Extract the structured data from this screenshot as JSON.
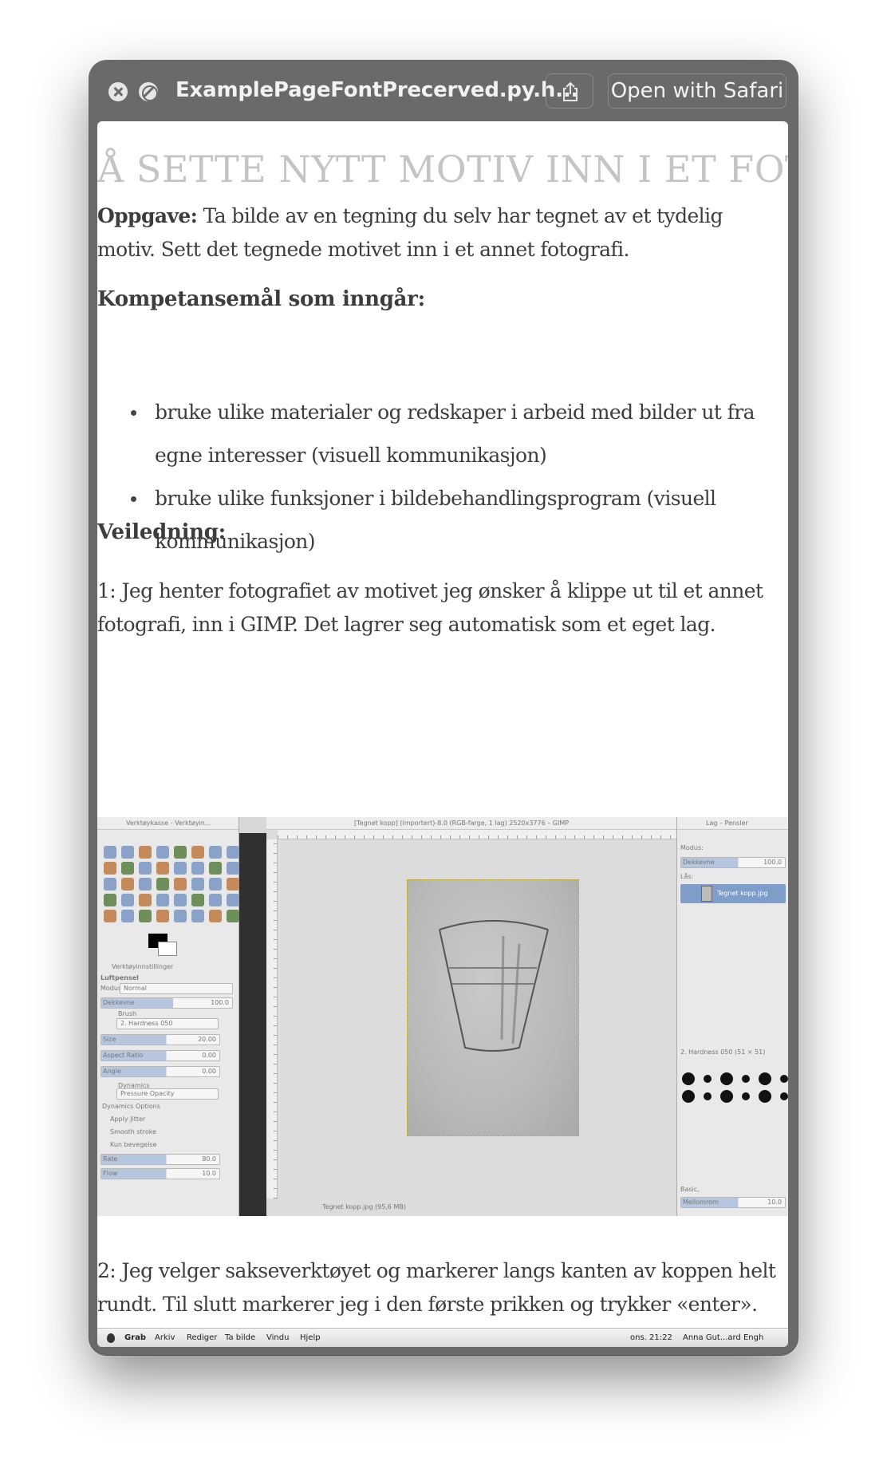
{
  "window": {
    "title": "ExamplePageFontPrecerved.py.h...",
    "open_with_label": "Open with Safari",
    "icons": [
      "close-icon",
      "block-icon",
      "share-icon"
    ]
  },
  "page": {
    "heading": "Å SETTE NYTT MOTIV INN I ET FOTO",
    "task_label": "Oppgave:",
    "task_text": " Ta bilde av en tegning du selv har tegnet av et tydelig motiv. Sett det tegnede motivet inn i et annet fotografi.",
    "competence_heading": "Kompetansemål som inngår:",
    "competence_items": [
      "bruke ulike materialer og redskaper i arbeid med bilder ut fra egne interesser (visuell kommunikasjon)",
      "bruke ulike funksjoner i bildebehandlingsprogram (visuell kommunikasjon)"
    ],
    "guidance_heading": "Veiledning:",
    "step1": "1: Jeg henter fotografiet av motivet jeg ønsker å klippe ut til et annet fotografi, inn i GIMP. Det lagrer seg automatisk som et eget lag.",
    "step2": "2: Jeg velger sakseverktøyet og markerer langs kanten av koppen helt rundt. Til slutt markerer jeg i den første prikken og trykker «enter». Koppen blir klippet ut."
  },
  "gimp_screenshot": {
    "toolbox_title": "Verktøykasse - Verktøyin...",
    "canvas_title": "[Tegnet kopp] (importert)-8.0 (RGB-farge, 1 lag) 2520x3776 – GIMP",
    "layers_title": "Lag – Pensler",
    "tool_options_label": "Verktøyinnstillinger",
    "tool_name": "Luftpensel",
    "mode_label": "Modus:",
    "mode_value": "Normal",
    "opacity_label": "Dekkevne",
    "opacity_value": "100.0",
    "brush_label": "Brush",
    "brush_value": "2. Hardness 050",
    "size_label": "Size",
    "size_value": "20.00",
    "aspect_label": "Aspect Ratio",
    "aspect_value": "0.00",
    "angle_label": "Angle",
    "angle_value": "0.00",
    "dynamics_label": "Dynamics",
    "dynamics_value": "Pressure Opacity",
    "dynamics_options": "Dynamics Options",
    "apply_jitter": "Apply Jitter",
    "smooth_stroke": "Smooth stroke",
    "kun_bevegelse": "Kun bevegelse",
    "rate_label": "Rate",
    "rate_value": "80.0",
    "flow_label": "Flow",
    "flow_value": "10.0",
    "layer_lock_label": "Lås:",
    "layer_name": "Tegnet kopp.jpg",
    "brush_set_label": "2. Hardness 050 (51 × 51)",
    "basic_label": "Basic,",
    "spacing_label": "Mellomrom",
    "spacing_value": "10.0",
    "status_text": "Tegnet kopp.jpg (95,6 MB)",
    "ruler_marks": [
      "2000",
      "1000",
      "0",
      "1000",
      "2000",
      "3000"
    ]
  },
  "menubar": {
    "app": "Grab",
    "items": [
      "Arkiv",
      "Rediger",
      "Ta bilde",
      "Vindu",
      "Hjelp"
    ],
    "clock": "ons. 21:22",
    "user": "Anna Gut...ard Engh"
  }
}
